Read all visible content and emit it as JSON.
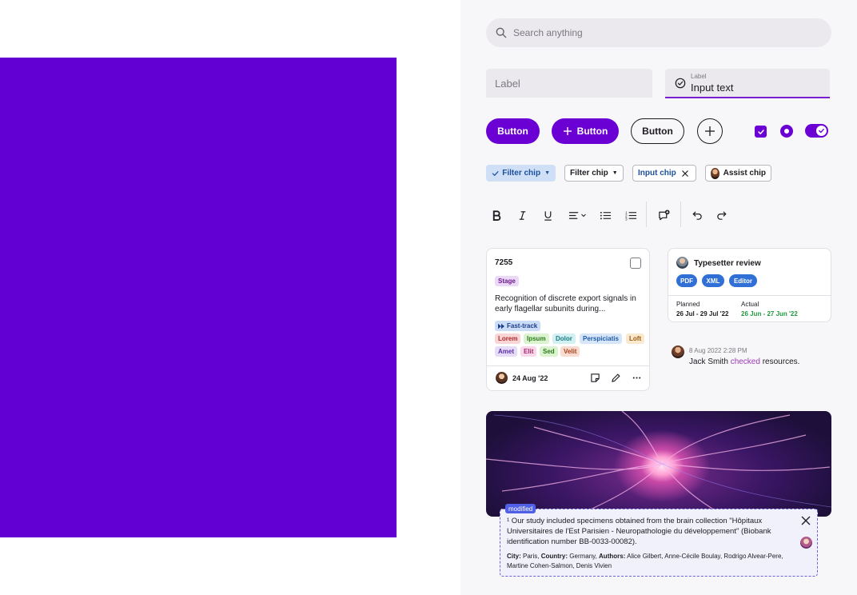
{
  "search": {
    "placeholder": "Search anything"
  },
  "fields": {
    "empty_label": "Label",
    "filled_label": "Label",
    "filled_value": "Input text"
  },
  "buttons": {
    "filled": "Button",
    "filled_icon": "Button",
    "outlined": "Button"
  },
  "chips": {
    "filter_selected": "Filter chip",
    "filter": "Filter chip",
    "input": "Input chip",
    "assist": "Assist chip"
  },
  "card_task": {
    "id": "7255",
    "stage": "Stage",
    "description": "Recognition of discrete export signals in early flagellar subunits during...",
    "priority": "Fast-track",
    "tags": [
      {
        "label": "Lorem",
        "bg": "#f9d6d6",
        "fg": "#b0262a"
      },
      {
        "label": "Ipsum",
        "bg": "#dcf3cf",
        "fg": "#2b7a1d"
      },
      {
        "label": "Dolor",
        "bg": "#d3f0f2",
        "fg": "#1d7a84"
      },
      {
        "label": "Perspiciatis",
        "bg": "#d6e6f8",
        "fg": "#1e5aa6"
      },
      {
        "label": "Loft",
        "bg": "#fbe9cf",
        "fg": "#9a5a10"
      },
      {
        "label": "Amet",
        "bg": "#e6dcf8",
        "fg": "#5b2ea8"
      },
      {
        "label": "Elit",
        "bg": "#f9d8ea",
        "fg": "#a5296f"
      },
      {
        "label": "Sed",
        "bg": "#dcf3cf",
        "fg": "#2b7a1d"
      },
      {
        "label": "Velit",
        "bg": "#f9dccf",
        "fg": "#a8421d"
      }
    ],
    "date": "24 Aug '22"
  },
  "card_review": {
    "title": "Typesetter review",
    "pills": [
      "PDF",
      "XML",
      "Editor"
    ],
    "planned_label": "Planned",
    "planned_value": "26 Jul - 29 Jul '22",
    "actual_label": "Actual",
    "actual_value": "26 Jun - 27 Jun '22",
    "actual_color": "#1f9a3e"
  },
  "activity": {
    "time": "8 Aug 2022 2:28 PM",
    "user": "Jack Smith",
    "action": "checked",
    "object": "resources."
  },
  "footnote": {
    "badge": "modified",
    "text": "¹ Our study included specimens obtained from the brain collection \"Hôpitaux Universitaires de l'Est Parisien - Neuropathologie du développement\" (Biobank identification number BB-0033-00082).",
    "city_label": "City:",
    "city": "Paris,",
    "country_label": "Country:",
    "country": "Germany,",
    "authors_label": "Authors:",
    "authors": "Alice Gilbert, Anne-Cécile Boulay, Rodrigo Alvear-Pere, Martine Cohen-Salmon, Denis Vivien"
  },
  "colors": {
    "primary": "#6200d3",
    "accent": "#6a00d4",
    "chip_selected_bg": "#cfe0f6",
    "link": "#1b4f9c"
  }
}
